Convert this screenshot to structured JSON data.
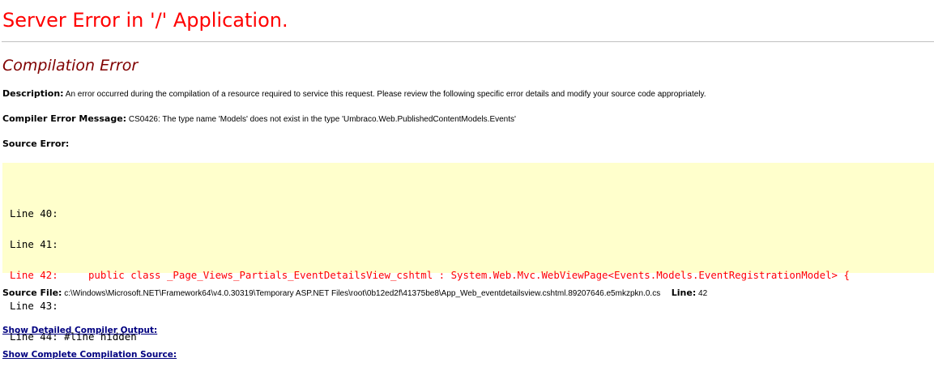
{
  "page": {
    "heading": "Server Error in '/' Application.",
    "sub_heading": "Compilation Error"
  },
  "description": {
    "label": "Description:",
    "text": "An error occurred during the compilation of a resource required to service this request. Please review the following specific error details and modify your source code appropriately."
  },
  "compiler_error": {
    "label": "Compiler Error Message:",
    "text": "CS0426: The type name 'Models' does not exist in the type 'Umbraco.Web.PublishedContentModels.Events'"
  },
  "source_error": {
    "label": "Source Error:",
    "lines": [
      {
        "text": "Line 40:",
        "is_error": false
      },
      {
        "text": "Line 41:",
        "is_error": false
      },
      {
        "text": "Line 42:     public class _Page_Views_Partials_EventDetailsView_cshtml : System.Web.Mvc.WebViewPage<Events.Models.EventRegistrationModel> {",
        "is_error": true
      },
      {
        "text": "Line 43:",
        "is_error": false
      },
      {
        "text": "Line 44: #line hidden",
        "is_error": false
      }
    ]
  },
  "source_file": {
    "label": "Source File:",
    "path": "c:\\Windows\\Microsoft.NET\\Framework64\\v4.0.30319\\Temporary ASP.NET Files\\root\\0b12ed2f\\41375be8\\App_Web_eventdetailsview.cshtml.89207646.e5mkzpkn.0.cs",
    "line_label": "Line:",
    "line_number": "42"
  },
  "links": {
    "detailed_output": "Show Detailed Compiler Output:",
    "complete_source": "Show Complete Compilation Source:"
  },
  "colors": {
    "heading": "#ff0000",
    "sub_heading": "#800000",
    "code_background": "#ffffcc",
    "error_line": "#ff0000",
    "link": "#000080"
  }
}
